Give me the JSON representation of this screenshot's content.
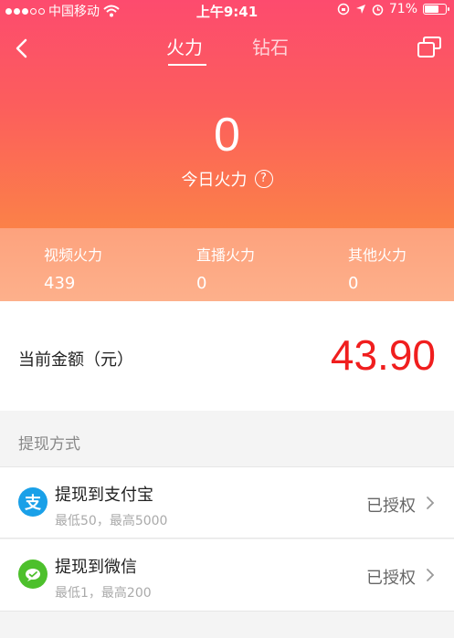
{
  "status_bar": {
    "carrier": "中国移动",
    "time": "上午9:41",
    "battery": "71%",
    "battery_level": 0.71
  },
  "nav": {
    "tabs": [
      {
        "label": "火力",
        "active": true
      },
      {
        "label": "钻石",
        "active": false
      }
    ],
    "back_icon": "chevron-left-icon",
    "share_icon": "share-icon"
  },
  "hero": {
    "today_value": "0",
    "today_label": "今日火力",
    "help_icon": "?"
  },
  "stats": [
    {
      "label": "视频火力",
      "value": "439"
    },
    {
      "label": "直播火力",
      "value": "0"
    },
    {
      "label": "其他火力",
      "value": "0"
    }
  ],
  "amount": {
    "label": "当前金额（元）",
    "value": "43.90"
  },
  "withdraw": {
    "section_title": "提现方式",
    "methods": [
      {
        "title": "提现到支付宝",
        "sub": "最低50，最高5000",
        "status": "已授权",
        "icon_char": "支"
      },
      {
        "title": "提现到微信",
        "sub": "最低1，最高200",
        "status": "已授权",
        "icon": "wechat-icon"
      }
    ]
  },
  "colors": {
    "accent": "#fd4b6e",
    "amount": "#f01e1e",
    "alipay": "#1aa0e8",
    "wechat": "#4dc02c"
  }
}
